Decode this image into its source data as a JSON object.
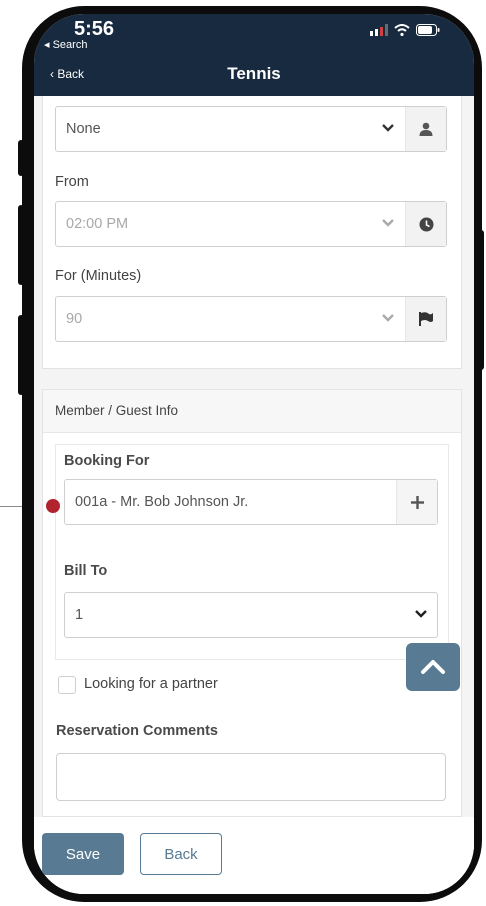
{
  "status_bar": {
    "time": "5:56",
    "back_app": "Search"
  },
  "nav": {
    "back": "Back",
    "title": "Tennis"
  },
  "booking": {
    "player_select": "None",
    "from_label": "From",
    "from_value": "02:00 PM",
    "minutes_label": "For (Minutes)",
    "minutes_value": "90"
  },
  "member_info": {
    "section_title": "Member / Guest Info",
    "booking_for_label": "Booking For",
    "booking_for_value": "001a - Mr. Bob  Johnson Jr.",
    "bill_to_label": "Bill To",
    "bill_to_value": "1"
  },
  "partner_checkbox_label": "Looking for a partner",
  "comments_label": "Reservation Comments",
  "comments_value": "",
  "actions": {
    "save": "Save",
    "back": "Back"
  },
  "icons": [
    "chevron-down-icon",
    "user-icon",
    "clock-icon",
    "flag-icon",
    "plus-icon",
    "chevron-up-icon",
    "signal-icon",
    "wifi-icon",
    "battery-icon"
  ],
  "colors": {
    "nav_bg": "#182a3f",
    "primary_button": "#587a93",
    "callout": "#b1242e"
  }
}
